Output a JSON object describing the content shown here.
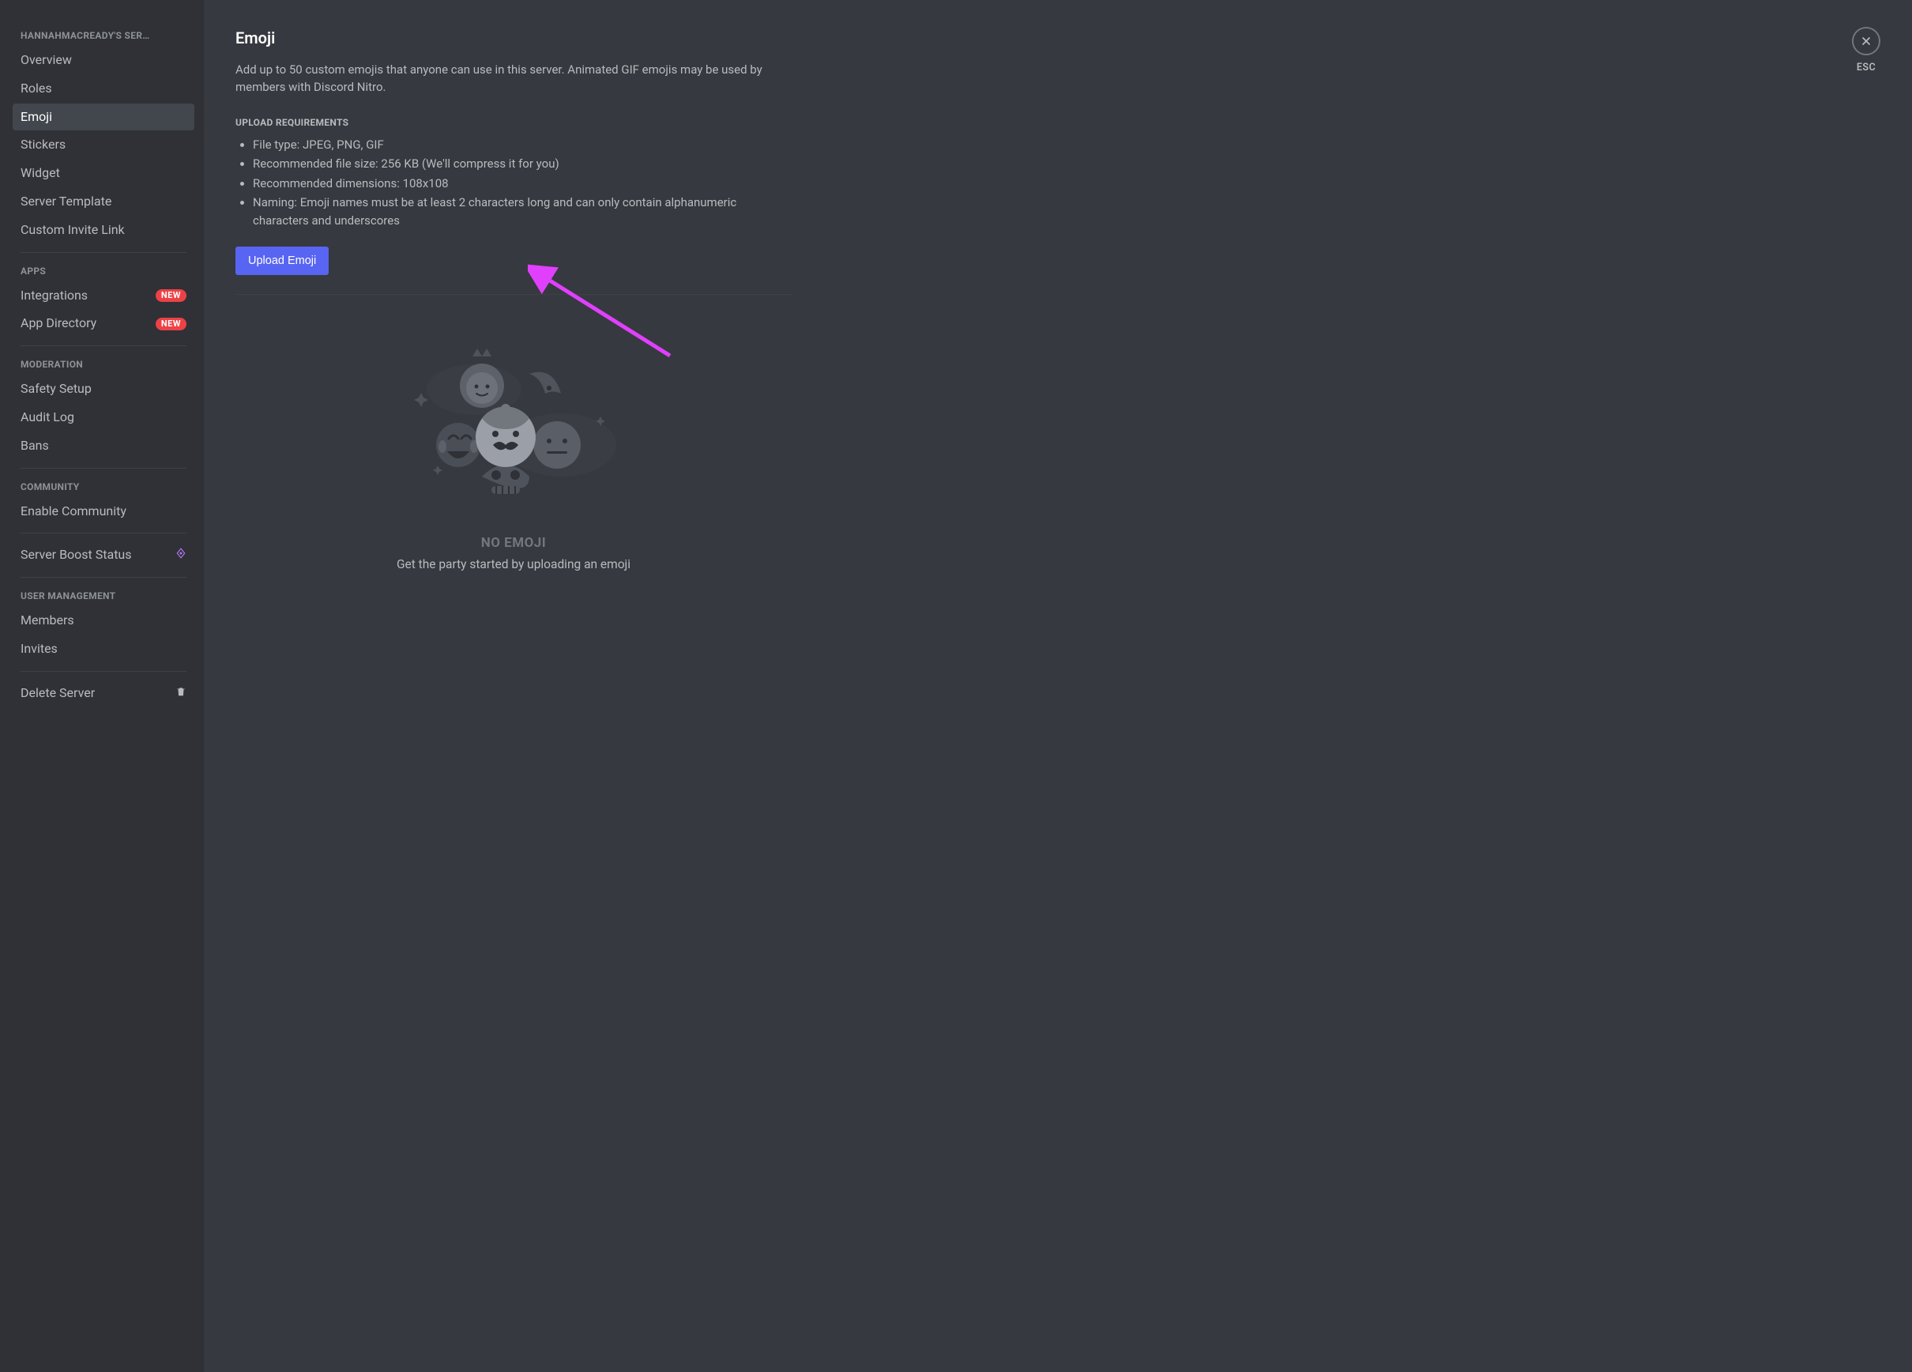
{
  "sidebar": {
    "server_label": "HANNAHMACREADY'S SER…",
    "groups": [
      {
        "header": null,
        "items": [
          {
            "id": "overview",
            "label": "Overview"
          },
          {
            "id": "roles",
            "label": "Roles"
          },
          {
            "id": "emoji",
            "label": "Emoji",
            "selected": true
          },
          {
            "id": "stickers",
            "label": "Stickers"
          },
          {
            "id": "widget",
            "label": "Widget"
          },
          {
            "id": "server-template",
            "label": "Server Template"
          },
          {
            "id": "custom-invite-link",
            "label": "Custom Invite Link"
          }
        ]
      },
      {
        "header": "APPS",
        "items": [
          {
            "id": "integrations",
            "label": "Integrations",
            "badge": "NEW"
          },
          {
            "id": "app-directory",
            "label": "App Directory",
            "badge": "NEW"
          }
        ]
      },
      {
        "header": "MODERATION",
        "items": [
          {
            "id": "safety-setup",
            "label": "Safety Setup"
          },
          {
            "id": "audit-log",
            "label": "Audit Log"
          },
          {
            "id": "bans",
            "label": "Bans"
          }
        ]
      },
      {
        "header": "COMMUNITY",
        "items": [
          {
            "id": "enable-community",
            "label": "Enable Community"
          }
        ]
      },
      {
        "header": null,
        "items": [
          {
            "id": "server-boost-status",
            "label": "Server Boost Status",
            "icon": "boost-gem"
          }
        ]
      },
      {
        "header": "USER MANAGEMENT",
        "items": [
          {
            "id": "members",
            "label": "Members"
          },
          {
            "id": "invites",
            "label": "Invites"
          }
        ]
      },
      {
        "header": null,
        "items": [
          {
            "id": "delete-server",
            "label": "Delete Server",
            "icon": "trash"
          }
        ]
      }
    ]
  },
  "main": {
    "title": "Emoji",
    "description": "Add up to 50 custom emojis that anyone can use in this server. Animated GIF emojis may be used by members with Discord Nitro.",
    "requirements_header": "UPLOAD REQUIREMENTS",
    "requirements": [
      "File type: JPEG, PNG, GIF",
      "Recommended file size: 256 KB (We'll compress it for you)",
      "Recommended dimensions: 108x108",
      "Naming: Emoji names must be at least 2 characters long and can only contain alphanumeric characters and underscores"
    ],
    "upload_button": "Upload Emoji",
    "empty_state": {
      "title": "NO EMOJI",
      "subtitle": "Get the party started by uploading an emoji"
    },
    "close_label": "ESC"
  },
  "colors": {
    "accent": "#5865f2",
    "badge_red": "#ed4245",
    "boost_purple": "#b377f3",
    "annotation_arrow": "#e040fb"
  }
}
